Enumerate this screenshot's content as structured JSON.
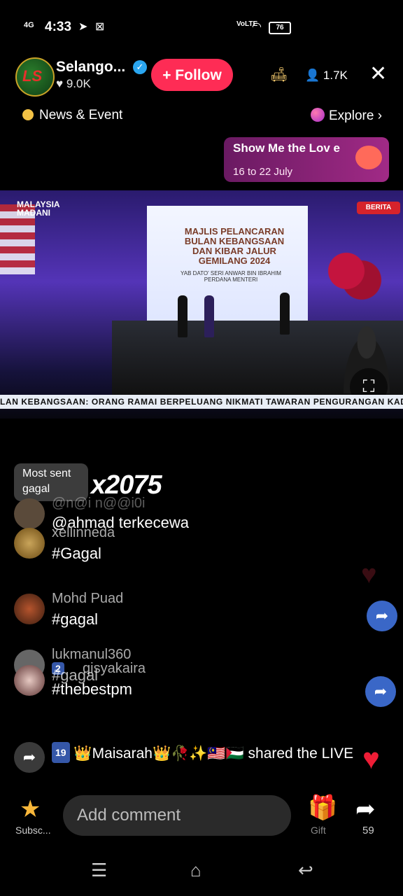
{
  "status_bar": {
    "time": "4:33",
    "network": "4G",
    "volte": "VoLTE",
    "battery": "76"
  },
  "header": {
    "host_name": "Selango...",
    "likes": "9.0K",
    "follow_label": "+ Follow",
    "viewers": "1.7K",
    "avatar_text": "LS"
  },
  "subheader": {
    "news": "News & Event",
    "explore": "Explore"
  },
  "promo": {
    "title": "Show Me the Lov e",
    "dates": "16 to 22 July"
  },
  "video": {
    "logo": "MALAYSIA MADANI",
    "berita": "BERITA",
    "screen_title": "MAJLIS PELANCARAN BULAN KEBANGSAAN DAN KIBAR JALUR GEMILANG 2024",
    "screen_sub": "YAB DATO' SERI ANWAR BIN IBRAHIM PERDANA MENTERI",
    "ticker": "LAN KEBANGSAAN: ORANG RAMAI BERPELUANG NIKMATI TAWARAN PENGURANGAN KADAR K"
  },
  "gift_combo": {
    "label_1": "Most sent",
    "label_2": "gagal",
    "count": "x2075"
  },
  "chat": [
    {
      "user": "@n@i n@@i0i",
      "msg": "@ahmad terkecewa",
      "ghost": true
    },
    {
      "user": "xellinneda",
      "msg": "#Gagal"
    },
    {
      "user": "Mohd Puad",
      "msg": "#gagal"
    },
    {
      "user": "lukmanul360",
      "msg": "#gagal",
      "badge": "2",
      "overlay_user": "qisyakaira",
      "overlay_msg": "#thebestpm"
    }
  ],
  "shared": {
    "badge": "19",
    "text": "👑Maisarah👑🥀✨🇲🇾🇵🇸 shared the LIVE"
  },
  "bottom": {
    "subscribe": "Subsc...",
    "comment_placeholder": "Add comment",
    "gift": "Gift",
    "share_count": "59"
  }
}
